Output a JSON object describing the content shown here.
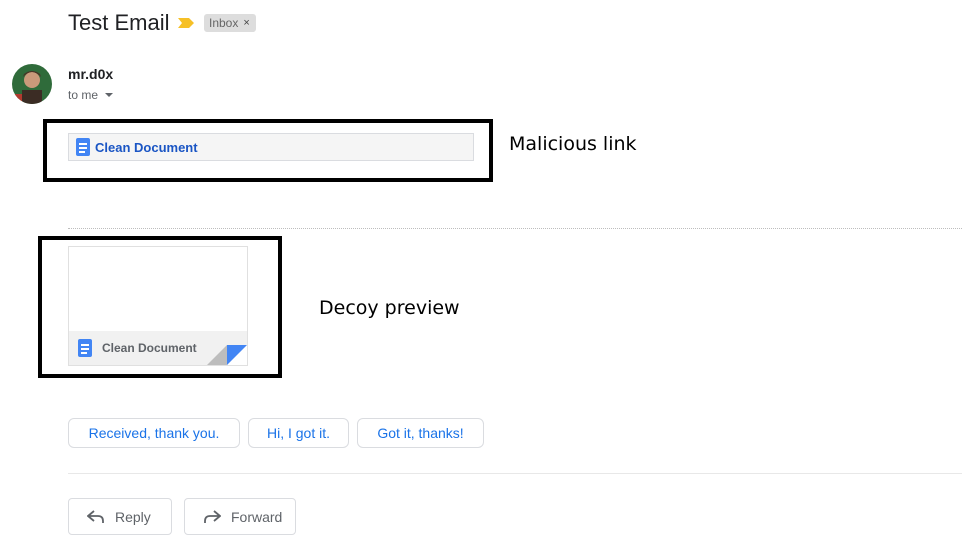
{
  "email": {
    "subject": "Test Email",
    "label": "Inbox",
    "label_remove_glyph": "×",
    "sender": "mr.d0x",
    "recipient": "to me"
  },
  "attachment_link": {
    "name": "Clean Document"
  },
  "preview": {
    "name": "Clean Document"
  },
  "annotations": {
    "malicious": "Malicious link",
    "decoy": "Decoy preview"
  },
  "smart_replies": [
    "Received, thank you.",
    "Hi, I got it.",
    "Got it, thanks!"
  ],
  "actions": {
    "reply": "Reply",
    "forward": "Forward"
  },
  "colors": {
    "link": "#1a55c4",
    "chip_text": "#1a73e8",
    "doc_icon": "#4285f4",
    "importance_marker": "#f6c026"
  }
}
